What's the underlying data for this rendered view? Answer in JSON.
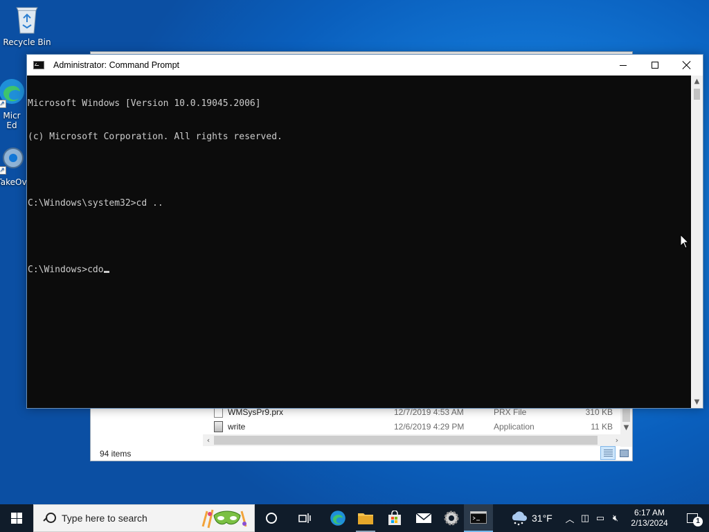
{
  "desktop": {
    "icons": [
      {
        "label": "Recycle Bin"
      },
      {
        "label": "Micr\nEd"
      },
      {
        "label": "TakeOv"
      }
    ]
  },
  "explorer": {
    "rows": [
      {
        "name": "WMSysPr9.prx",
        "date": "12/7/2019 4:53 AM",
        "type": "PRX File",
        "size": "310 KB"
      },
      {
        "name": "write",
        "date": "12/6/2019 4:29 PM",
        "type": "Application",
        "size": "11 KB"
      }
    ],
    "status": "94 items"
  },
  "cmd": {
    "title": "Administrator: Command Prompt",
    "lines": [
      "Microsoft Windows [Version 10.0.19045.2006]",
      "(c) Microsoft Corporation. All rights reserved.",
      "",
      "C:\\Windows\\system32>cd ..",
      "",
      "C:\\Windows>cdo"
    ]
  },
  "taskbar": {
    "search_placeholder": "Type here to search",
    "weather": {
      "temp": "31°F",
      "icon": "cloud-snow-icon"
    },
    "clock": {
      "time": "6:17 AM",
      "date": "2/13/2024"
    },
    "notification_count": "1",
    "pinned": [
      "edge-icon",
      "file-explorer-icon",
      "store-icon",
      "mail-icon",
      "settings-icon",
      "command-prompt-icon"
    ]
  }
}
